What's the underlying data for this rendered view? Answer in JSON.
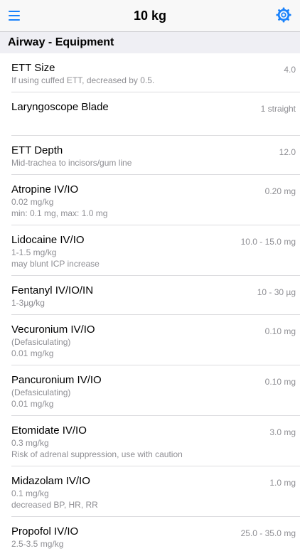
{
  "nav": {
    "title": "10 kg",
    "menu_icon": "hamburger-menu-icon",
    "settings_icon": "gear-icon",
    "accent_color": "#1a82fb"
  },
  "section": {
    "title": "Airway - Equipment",
    "background": "#efeff4"
  },
  "rows": [
    {
      "label": "ETT Size",
      "value": "4.0",
      "sub": [
        "If using cuffed ETT, decreased by 0.5."
      ]
    },
    {
      "label": "Laryngoscope Blade",
      "value": "1 straight",
      "sub": []
    },
    {
      "label": "ETT Depth",
      "value": "12.0",
      "sub": [
        "Mid-trachea to incisors/gum line"
      ]
    },
    {
      "label": "Atropine IV/IO",
      "value": "0.20 mg",
      "sub": [
        "0.02 mg/kg",
        "min: 0.1 mg, max: 1.0 mg"
      ]
    },
    {
      "label": "Lidocaine IV/IO",
      "value": "10.0 - 15.0 mg",
      "sub": [
        "1-1.5 mg/kg",
        "may blunt ICP increase"
      ]
    },
    {
      "label": "Fentanyl IV/IO/IN",
      "value": "10 - 30 µg",
      "sub": [
        "1-3µg/kg"
      ]
    },
    {
      "label": "Vecuronium IV/IO",
      "value": "0.10 mg",
      "sub": [
        "(Defasiculating)",
        "0.01 mg/kg"
      ]
    },
    {
      "label": "Pancuronium IV/IO",
      "value": "0.10 mg",
      "sub": [
        "(Defasiculating)",
        "0.01 mg/kg"
      ]
    },
    {
      "label": "Etomidate IV/IO",
      "value": "3.0 mg",
      "sub": [
        "0.3 mg/kg",
        "Risk of adrenal suppression, use with caution"
      ]
    },
    {
      "label": "Midazolam IV/IO",
      "value": "1.0 mg",
      "sub": [
        "0.1 mg/kg",
        "decreased BP, HR, RR"
      ]
    },
    {
      "label": "Propofol IV/IO",
      "value": "25.0 - 35.0 mg",
      "sub": [
        "2.5-3.5 mg/kg"
      ]
    }
  ]
}
